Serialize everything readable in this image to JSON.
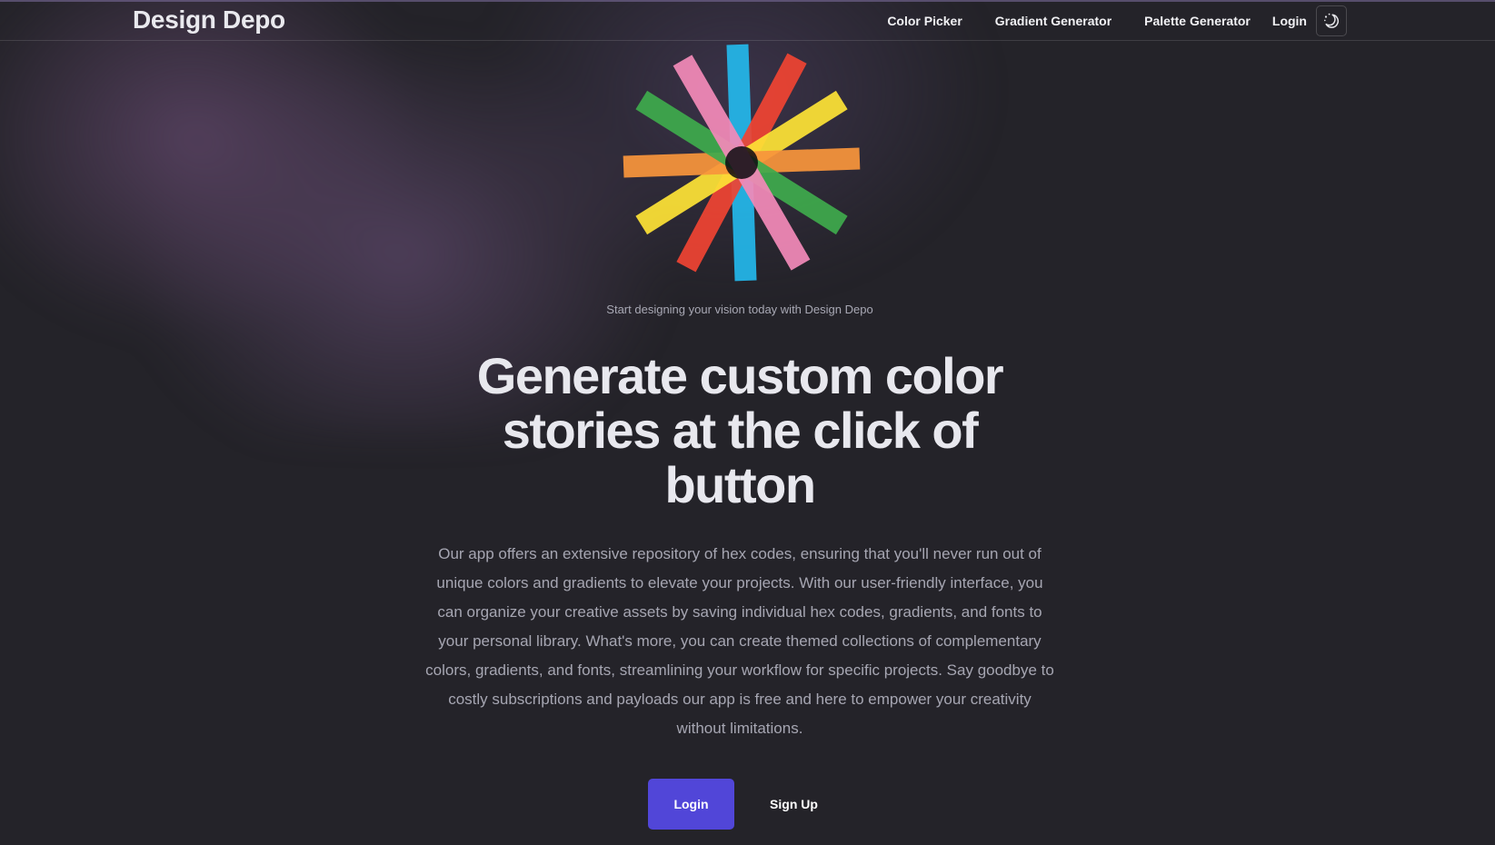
{
  "nav": {
    "brand": "Design Depo",
    "links": [
      "Color Picker",
      "Gradient Generator",
      "Palette Generator"
    ],
    "login_label": "Login",
    "theme_toggle_icon": "moon-stars-icon"
  },
  "hero": {
    "logo_icon": "color-starburst-logo-icon",
    "logo_colors": [
      "#23b7ea",
      "#ef4433",
      "#fde236",
      "#f7953b",
      "#3eaa4c",
      "#f28ab8"
    ],
    "tagline": "Start designing your vision today with Design Depo",
    "headline": "Generate custom color stories at the click of button",
    "description": "Our app offers an extensive repository of hex codes, ensuring that you'll never run out of unique colors and gradients to elevate your projects. With our user-friendly interface, you can organize your creative assets by saving individual hex codes, gradients, and fonts to your personal library. What's more, you can create themed collections of complementary colors, gradients, and fonts, streamlining your workflow for specific projects. Say goodbye to costly subscriptions and payloads our app is free and here to empower your creativity without limitations."
  },
  "cta": {
    "login_label": "Login",
    "signup_label": "Sign Up"
  },
  "colors": {
    "background": "#242329",
    "primary_button": "#5146d8",
    "heading": "#e8e8ee",
    "body_text": "#a6a6b2"
  }
}
